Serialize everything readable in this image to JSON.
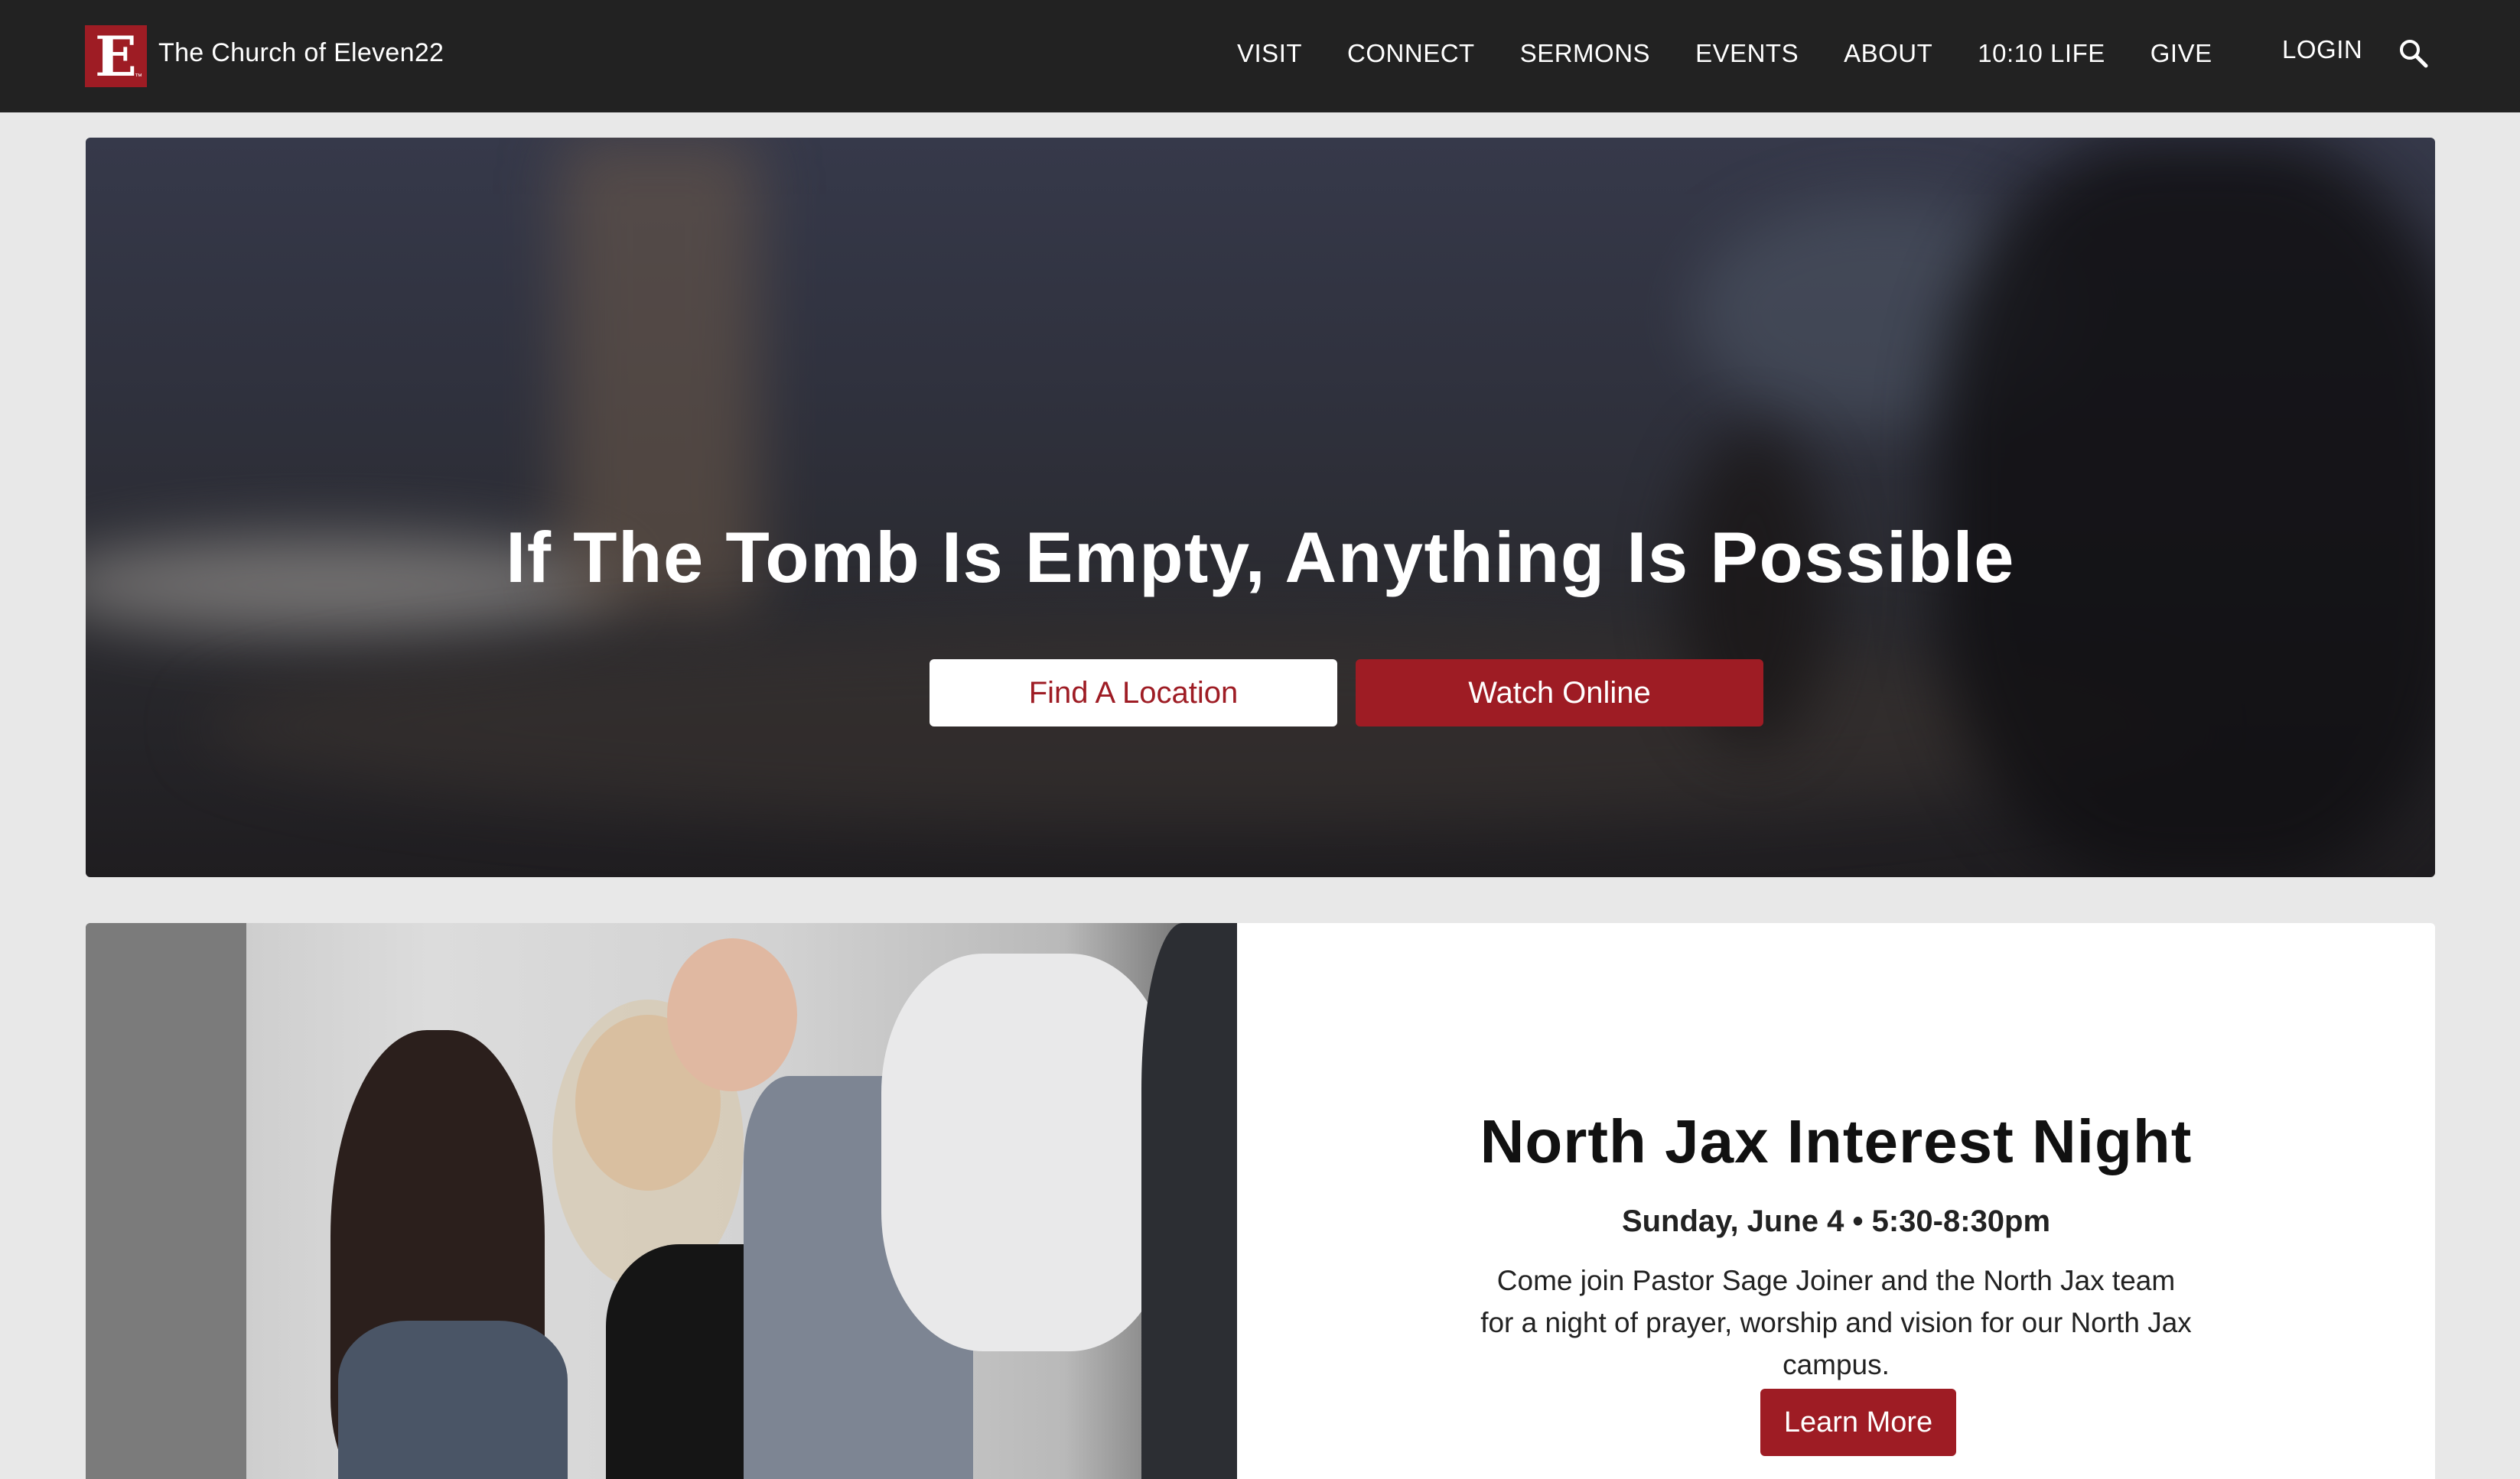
{
  "brand": {
    "logo_letter": "E",
    "logo_tm": "™",
    "name": "The Church of Eleven22",
    "color": "#9e1c24"
  },
  "nav": {
    "items": [
      "VISIT",
      "CONNECT",
      "SERMONS",
      "EVENTS",
      "ABOUT",
      "10:10 LIFE",
      "GIVE"
    ],
    "login": "LOGIN",
    "search_icon": "search-icon"
  },
  "hero": {
    "title": "If The Tomb Is Empty, Anything Is Possible",
    "find_button": "Find A Location",
    "watch_button": "Watch Online"
  },
  "feature": {
    "title": "North Jax Interest Night",
    "date": "Sunday, June 4 • 5:30-8:30pm",
    "description": "Come join Pastor Sage Joiner and the North Jax team for a night of prayer, worship and vision for our North Jax campus.",
    "button": "Learn More"
  }
}
